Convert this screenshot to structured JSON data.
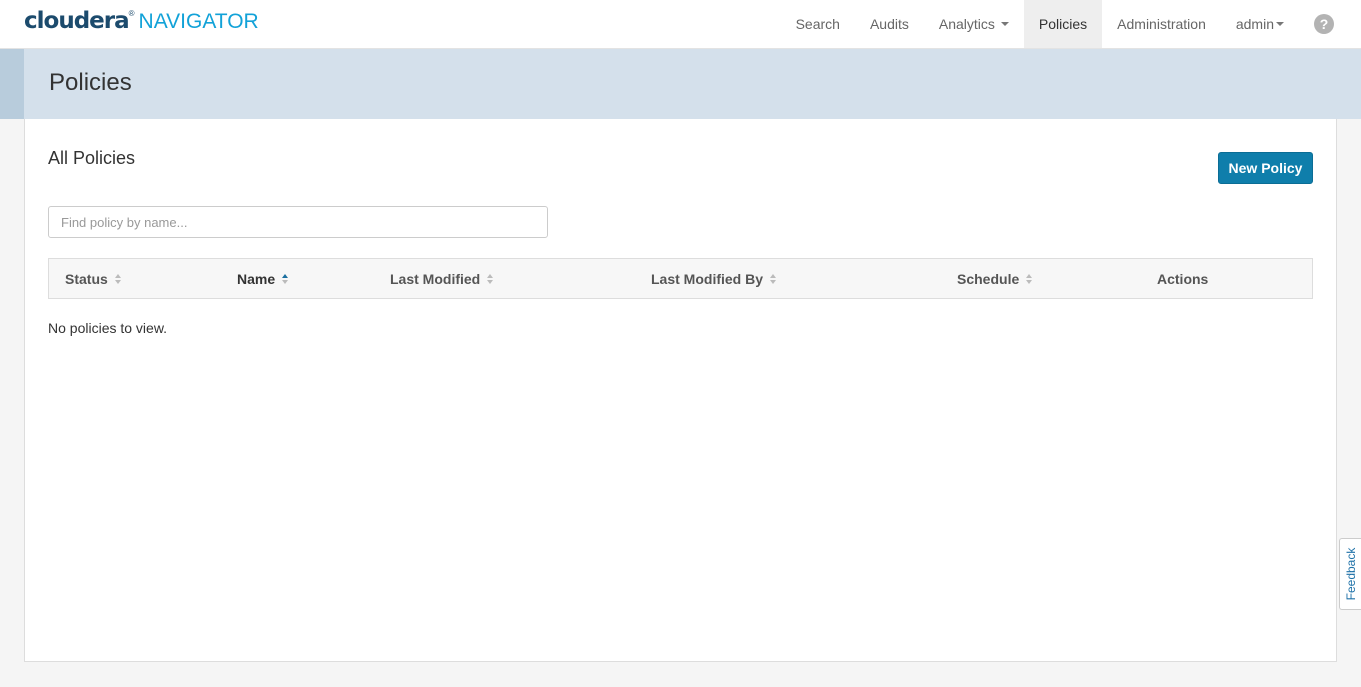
{
  "brand": {
    "primary": "cloudera",
    "reg_mark": "®",
    "secondary": "NAVIGATOR",
    "colors": {
      "primary": "#1c4b6d",
      "secondary": "#12a2d8"
    }
  },
  "nav": {
    "search": "Search",
    "audits": "Audits",
    "analytics": "Analytics",
    "policies": "Policies",
    "administration": "Administration",
    "user": "admin",
    "help_glyph": "?",
    "active": "policies"
  },
  "page": {
    "title": "Policies",
    "header_color": "#d4e0eb"
  },
  "policies": {
    "section_title": "All Policies",
    "new_button": "New Policy",
    "search_placeholder": "Find policy by name...",
    "search_value": "",
    "table": {
      "columns": [
        {
          "label": "Status",
          "sortable": true,
          "sort": "none"
        },
        {
          "label": "Name",
          "sortable": true,
          "sort": "asc"
        },
        {
          "label": "Last Modified",
          "sortable": true,
          "sort": "none"
        },
        {
          "label": "Last Modified By",
          "sortable": true,
          "sort": "none"
        },
        {
          "label": "Schedule",
          "sortable": true,
          "sort": "none"
        },
        {
          "label": "Actions",
          "sortable": false,
          "sort": "none"
        }
      ],
      "rows": []
    },
    "empty_message": "No policies to view.",
    "accent_color": "#0f7eab"
  },
  "feedback": {
    "label": "Feedback"
  },
  "icons": {
    "help": "help-icon",
    "sort": "sort-icon",
    "sort_asc": "sort-asc-icon",
    "dropdown": "chevron-down-icon"
  }
}
